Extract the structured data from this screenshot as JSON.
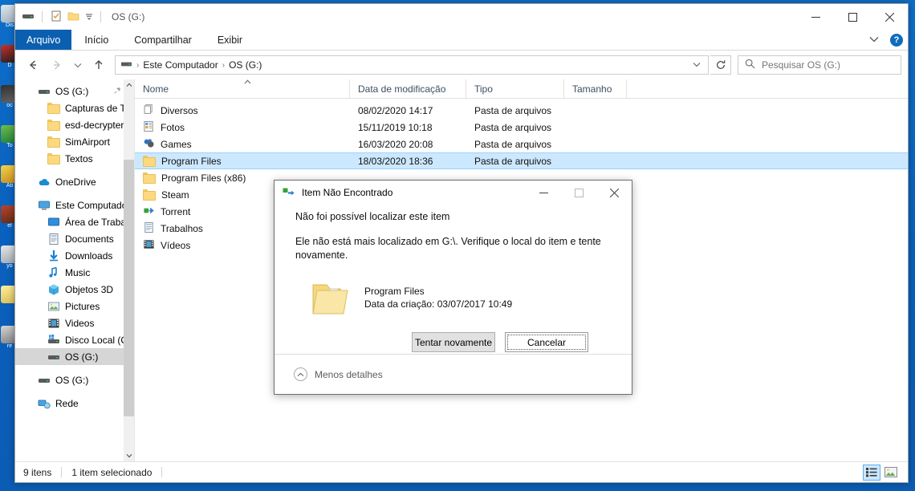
{
  "window": {
    "title": "OS (G:)",
    "quick_access": [
      "drive-icon",
      "properties-icon",
      "new-folder-icon",
      "customize-caret"
    ],
    "controls": {
      "minimize": "—",
      "maximize": "☐",
      "close": "✕"
    }
  },
  "ribbon": {
    "tabs": [
      {
        "label": "Arquivo",
        "active": true
      },
      {
        "label": "Início",
        "active": false
      },
      {
        "label": "Compartilhar",
        "active": false
      },
      {
        "label": "Exibir",
        "active": false
      }
    ],
    "collapse_caret": "∨",
    "help_label": "?"
  },
  "nav": {
    "back": "←",
    "forward": "→",
    "recent_caret": "∨",
    "up": "↑",
    "breadcrumb": [
      "Este Computador",
      "OS (G:)"
    ],
    "breadcrumb_separator": "›",
    "address_caret": "∨",
    "refresh": "↻"
  },
  "search": {
    "placeholder": "Pesquisar OS (G:)",
    "icon": "search-icon"
  },
  "sidebar": {
    "groups": [
      {
        "items": [
          {
            "label": "OS (G:)",
            "icon": "drive-icon",
            "indent": 1,
            "pinned": true
          },
          {
            "label": "Capturas de Tela",
            "icon": "folder-icon",
            "indent": 2
          },
          {
            "label": "esd-decrypter-w",
            "icon": "folder-icon",
            "indent": 2
          },
          {
            "label": "SimAirport",
            "icon": "folder-icon",
            "indent": 2
          },
          {
            "label": "Textos",
            "icon": "folder-icon",
            "indent": 2
          }
        ]
      },
      {
        "items": [
          {
            "label": "OneDrive",
            "icon": "cloud-icon",
            "indent": 0
          }
        ]
      },
      {
        "items": [
          {
            "label": "Este Computador",
            "icon": "pc-icon",
            "indent": 0
          },
          {
            "label": "Área de Trabalho",
            "icon": "desktop-icon",
            "indent": 1
          },
          {
            "label": "Documents",
            "icon": "documents-icon",
            "indent": 1
          },
          {
            "label": "Downloads",
            "icon": "downloads-icon",
            "indent": 1
          },
          {
            "label": "Music",
            "icon": "music-icon",
            "indent": 1
          },
          {
            "label": "Objetos 3D",
            "icon": "objects3d-icon",
            "indent": 1
          },
          {
            "label": "Pictures",
            "icon": "pictures-icon",
            "indent": 1
          },
          {
            "label": "Videos",
            "icon": "videos-icon",
            "indent": 1
          },
          {
            "label": "Disco Local (C:)",
            "icon": "windows-drive-icon",
            "indent": 1
          },
          {
            "label": "OS (G:)",
            "icon": "drive-icon",
            "indent": 1,
            "selected": true
          }
        ]
      },
      {
        "items": [
          {
            "label": "OS (G:)",
            "icon": "drive-icon",
            "indent": 0
          }
        ]
      },
      {
        "items": [
          {
            "label": "Rede",
            "icon": "network-icon",
            "indent": 0
          }
        ]
      }
    ]
  },
  "filelist": {
    "columns": [
      {
        "key": "name",
        "label": "Nome",
        "sorted": "asc"
      },
      {
        "key": "date",
        "label": "Data de modificação"
      },
      {
        "key": "type",
        "label": "Tipo"
      },
      {
        "key": "size",
        "label": "Tamanho"
      }
    ],
    "rows": [
      {
        "name": "Diversos",
        "date": "08/02/2020 14:17",
        "type": "Pasta de arquivos",
        "size": "",
        "icon": "stacked-folder-icon",
        "selected": false
      },
      {
        "name": "Fotos",
        "date": "15/11/2019 10:18",
        "type": "Pasta de arquivos",
        "size": "",
        "icon": "photos-folder-icon",
        "selected": false
      },
      {
        "name": "Games",
        "date": "16/03/2020 20:08",
        "type": "Pasta de arquivos",
        "size": "",
        "icon": "games-folder-icon",
        "selected": false
      },
      {
        "name": "Program Files",
        "date": "18/03/2020 18:36",
        "type": "Pasta de arquivos",
        "size": "",
        "icon": "folder-icon",
        "selected": true
      },
      {
        "name": "Program Files (x86)",
        "date": "",
        "type": "",
        "size": "",
        "icon": "folder-icon",
        "selected": false
      },
      {
        "name": "Steam",
        "date": "",
        "type": "",
        "size": "",
        "icon": "folder-icon",
        "selected": false
      },
      {
        "name": "Torrent",
        "date": "",
        "type": "",
        "size": "",
        "icon": "shortcut-folder-icon",
        "selected": false
      },
      {
        "name": "Trabalhos",
        "date": "",
        "type": "",
        "size": "",
        "icon": "documents-folder-icon",
        "selected": false
      },
      {
        "name": "Vídeos",
        "date": "",
        "type": "",
        "size": "",
        "icon": "videos-folder-icon",
        "selected": false
      }
    ]
  },
  "statusbar": {
    "item_count": "9 itens",
    "selection": "1 item selecionado",
    "views": [
      {
        "name": "details-view",
        "active": true
      },
      {
        "name": "large-icons-view",
        "active": false
      }
    ]
  },
  "dialog": {
    "title": "Item Não Encontrado",
    "title_icon": "move-item-icon",
    "controls": {
      "minimize": "—",
      "maximize": "☐",
      "close": "✕"
    },
    "heading": "Não foi possível localizar este item",
    "message": "Ele não está mais localizado em G:\\. Verifique o local do item e tente novamente.",
    "item": {
      "icon": "folder-large-icon",
      "name": "Program Files",
      "detail": "Data da criação: 03/07/2017 10:49"
    },
    "buttons": [
      {
        "label": "Tentar novamente",
        "primary": true
      },
      {
        "label": "Cancelar",
        "focused": true
      }
    ],
    "footer": {
      "caret": "∧",
      "label": "Menos detalhes"
    }
  },
  "colors": {
    "accent": "#0b5fb0",
    "selection": "#cce8ff",
    "desktop": "#0a63c2"
  }
}
